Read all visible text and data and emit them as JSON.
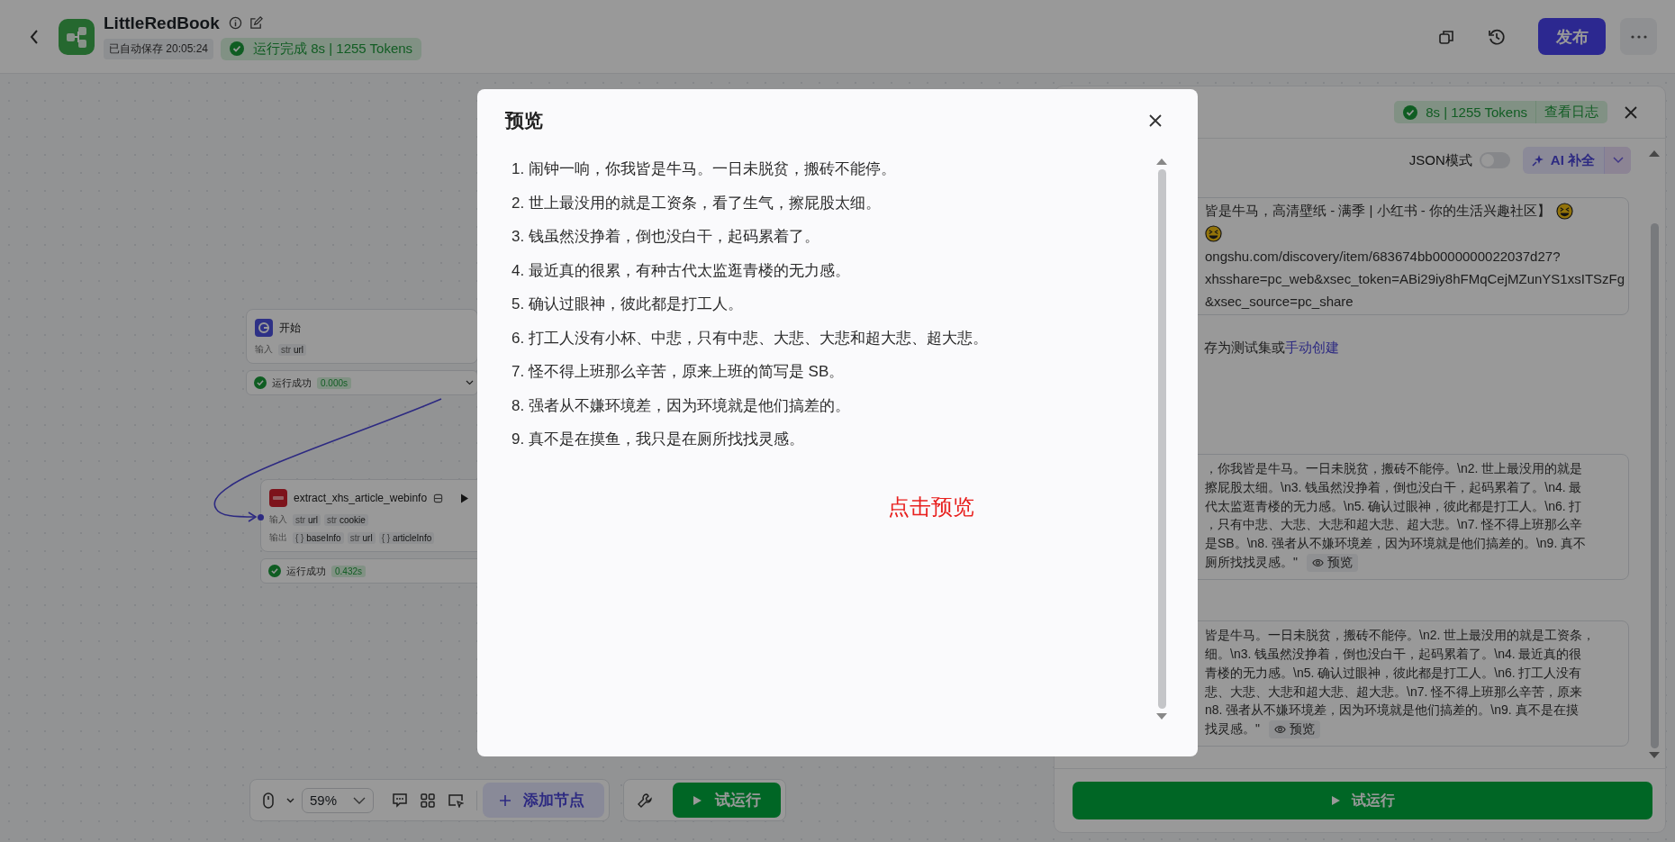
{
  "header": {
    "title": "LittleRedBook",
    "autosave": "已自动保存 20:05:24",
    "run_status": "运行完成 8s | 1255 Tokens",
    "publish": "发布"
  },
  "canvas": {
    "nodes": [
      {
        "kind": "start",
        "title": "开始",
        "inputs_label": "输入",
        "inputs": [
          {
            "type": "str",
            "name": "url"
          }
        ],
        "status": "运行成功",
        "duration": "0.000s"
      },
      {
        "kind": "plugin",
        "title": "extract_xhs_article_webinfo",
        "inputs_label": "输入",
        "inputs": [
          {
            "type": "str",
            "name": "url"
          },
          {
            "type": "str",
            "name": "cookie"
          }
        ],
        "outputs_label": "输出",
        "outputs": [
          {
            "type": "{ }",
            "name": "baseInfo"
          },
          {
            "type": "str",
            "name": "url"
          },
          {
            "type": "{ }",
            "name": "articleInfo"
          }
        ],
        "status": "运行成功",
        "duration": "0.432s"
      }
    ],
    "toolbar": {
      "zoom": "59%",
      "add_node": "添加节点",
      "test_run": "试运行"
    }
  },
  "panel": {
    "run_info": "8s | 1255 Tokens",
    "view_log": "查看日志",
    "json_mode": {
      "label": "JSON模式",
      "on": false
    },
    "ai_complete": "AI 补全",
    "input_lines": [
      {
        "text": "皆是牛马，高清壁纸 - 满季 | 小红书 - 你的生活兴趣社区】",
        "emoji": true
      },
      {
        "emoji": true
      },
      {
        "text": "ongshu.com/discovery/item/683674bb0000000022037d27?",
        "emoji": false
      },
      {
        "text": "xhsshare=pc_web&xsec_token=ABi29iy8hFMqCejMZunYS1xsITSzFg",
        "emoji": false
      },
      {
        "text": "&xsec_source=pc_share",
        "emoji": false
      }
    ],
    "save_hint": "存为测试集或",
    "save_link": "手动创建",
    "outputs": [
      {
        "lines": [
          "，你我皆是牛马。一日未脱贫，搬砖不能停。\\n2. 世上最没用的就是",
          "擦屁股太细。\\n3. 钱虽然没挣着，倒也没白干，起码累着了。\\n4. 最",
          "代太监逛青楼的无力感。\\n5. 确认过眼神，彼此都是打工人。\\n6. 打",
          "，只有中悲、大悲、大悲和超大悲、超大悲。\\n7. 怪不得上班那么辛",
          "是SB。\\n8. 强者从不嫌环境差，因为环境就是他们搞差的。\\n9. 真不",
          "厕所找找灵感。\""
        ],
        "preview": "预览"
      },
      {
        "lines": [
          "皆是牛马。一日未脱贫，搬砖不能停。\\n2. 世上最没用的就是工资条，",
          "细。\\n3. 钱虽然没挣着，倒也没白干，起码累着了。\\n4. 最近真的很",
          "青楼的无力感。\\n5. 确认过眼神，彼此都是打工人。\\n6. 打工人没有",
          "悲、大悲、大悲和超大悲、超大悲。\\n7. 怪不得上班那么辛苦，原来",
          "n8. 强者从不嫌环境差，因为环境就是他们搞差的。\\n9. 真不是在摸",
          "找灵感。\""
        ],
        "preview": "预览"
      }
    ],
    "test_run": "试运行"
  },
  "modal": {
    "title": "预览",
    "items": [
      "1. 闹钟一响，你我皆是牛马。一日未脱贫，搬砖不能停。",
      "2. 世上最没用的就是工资条，看了生气，擦屁股太细。",
      "3. 钱虽然没挣着，倒也没白干，起码累着了。",
      "4. 最近真的很累，有种古代太监逛青楼的无力感。",
      "5. 确认过眼神，彼此都是打工人。",
      "6. 打工人没有小杯、中悲，只有中悲、大悲、大悲和超大悲、超大悲。",
      "7. 怪不得上班那么辛苦，原来上班的简写是 SB。",
      "8. 强者从不嫌环境差，因为环境就是他们搞差的。",
      "9. 真不是在摸鱼，我只是在厕所找找灵感。"
    ],
    "note": "点击预览"
  }
}
